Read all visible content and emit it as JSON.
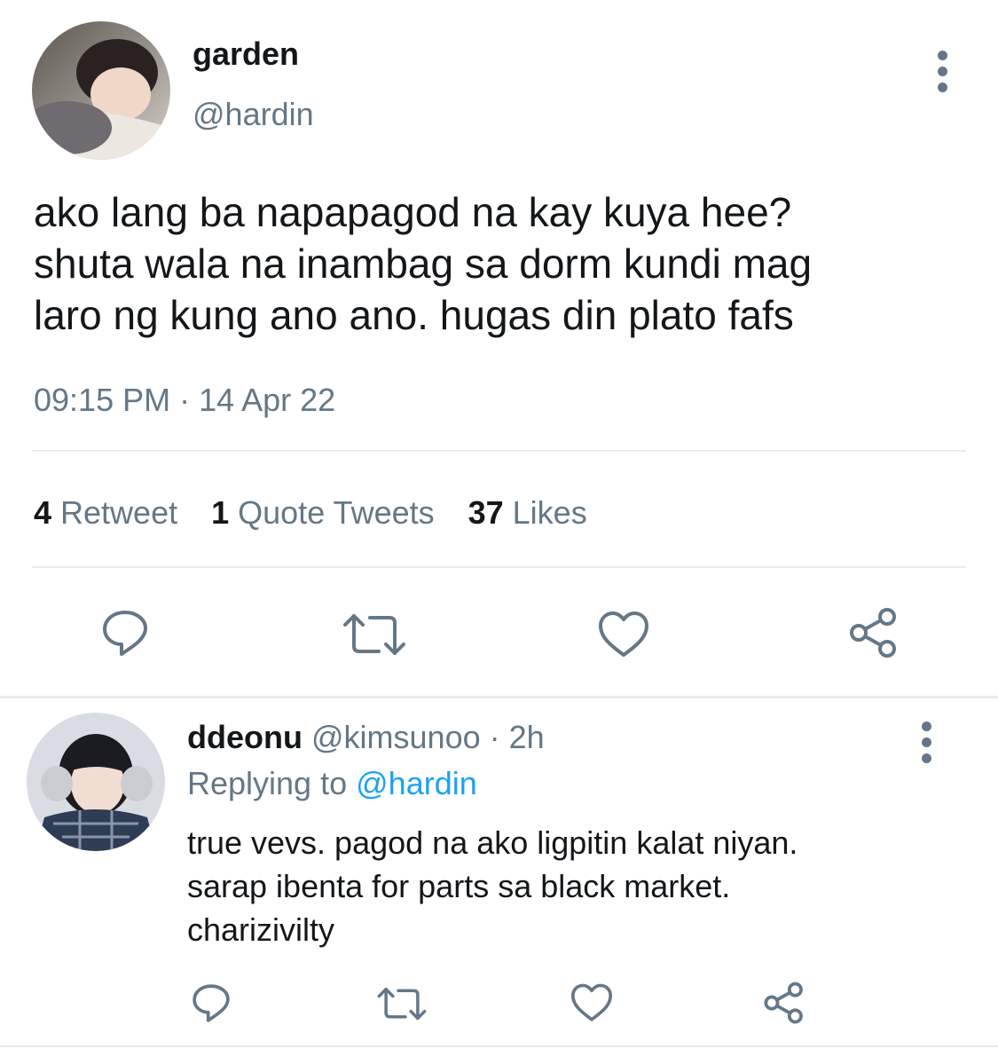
{
  "tweet": {
    "display_name": "garden",
    "handle": "@hardin",
    "text": "ako lang ba napapagod na kay kuya hee?\nshuta wala na inambag sa dorm kundi mag\nlaro ng kung ano ano. hugas din plato fafs",
    "timestamp": "09:15 PM · 14 Apr 22",
    "stats": {
      "retweets": {
        "count": "4",
        "label": "Retweet"
      },
      "quotes": {
        "count": "1",
        "label": "Quote Tweets"
      },
      "likes": {
        "count": "37",
        "label": "Likes"
      }
    },
    "actions": [
      "reply-icon",
      "retweet-icon",
      "like-icon",
      "share-icon"
    ]
  },
  "reply": {
    "display_name": "ddeonu",
    "meta": "@kimsunoo · 2h",
    "replying_prefix": "Replying to",
    "replying_mention": "@hardin",
    "text": "true vevs. pagod na ako ligpitin kalat niyan.\nsarap ibenta for parts sa black market.\ncharizivilty",
    "actions": [
      "reply-icon",
      "retweet-icon",
      "like-icon",
      "share-icon"
    ]
  },
  "colors": {
    "text_primary": "#14171a",
    "text_secondary": "#657786",
    "link": "#1da1f2",
    "divider": "#e6ecf0"
  }
}
